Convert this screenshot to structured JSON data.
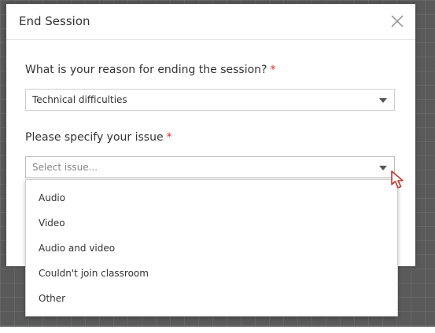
{
  "modal": {
    "title": "End Session",
    "close_icon": "close-icon"
  },
  "reason_field": {
    "label": "What is your reason for ending the session?",
    "required_mark": "*",
    "selected_value": "Technical difficulties",
    "caret_icon": "chevron-down-icon"
  },
  "issue_field": {
    "label": "Please specify your issue",
    "required_mark": "*",
    "placeholder": "Select issue...",
    "caret_icon": "chevron-down-icon",
    "options": [
      "Audio",
      "Video",
      "Audio and video",
      "Couldn't join classroom",
      "Other"
    ]
  },
  "colors": {
    "required": "#d0312d",
    "text": "#333333",
    "placeholder": "#888888",
    "cursor_outline": "#c0392b"
  },
  "cursor_icon": "pointer-cursor-icon"
}
